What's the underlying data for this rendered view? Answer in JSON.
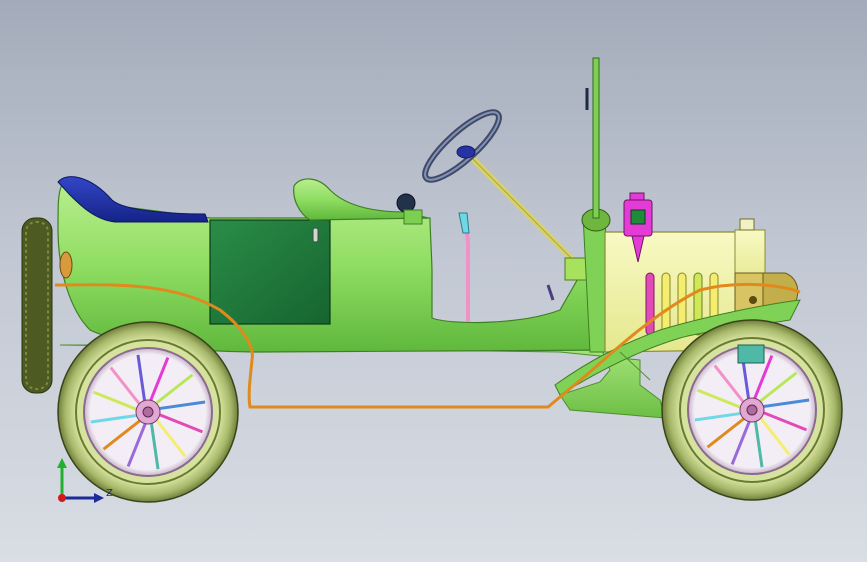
{
  "viewport": {
    "background_top": "#a3abba",
    "background_bottom": "#d9dde4"
  },
  "model": {
    "subject": "antique-touring-car",
    "body_color": "#8fdd62",
    "door_color": "#1f7a3a",
    "seat_color": "#1d2fa8",
    "hood_color": "#f3f5a8",
    "trim_color": "#e08a1e",
    "tire_color": "#b7c87e",
    "lamp_color": "#e02bd6"
  },
  "triad": {
    "axes": [
      {
        "name": "y",
        "color": "#22b02e",
        "label": ""
      },
      {
        "name": "z",
        "color": "#1c2a9a",
        "label": "Z"
      },
      {
        "name": "x",
        "color": "#d11919",
        "label": ""
      }
    ]
  }
}
